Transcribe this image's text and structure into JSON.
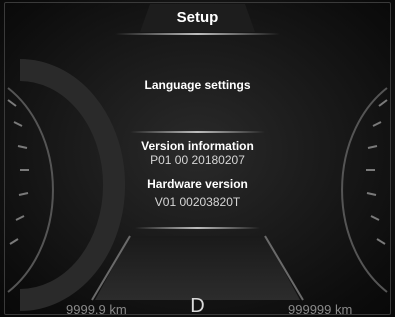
{
  "header": {
    "title": "Setup"
  },
  "menu": {
    "language_settings": "Language settings",
    "version_information": {
      "label": "Version information",
      "value": "P01 00 20180207"
    },
    "hardware_version": {
      "label": "Hardware version",
      "value": "V01 00203820T"
    }
  },
  "footer": {
    "trip_odometer": "9999.9 km",
    "gear": "D",
    "total_odometer": "999999 km"
  },
  "colors": {
    "text": "#ffffff",
    "dim_text": "#8a8a8a",
    "background": "#161616"
  }
}
